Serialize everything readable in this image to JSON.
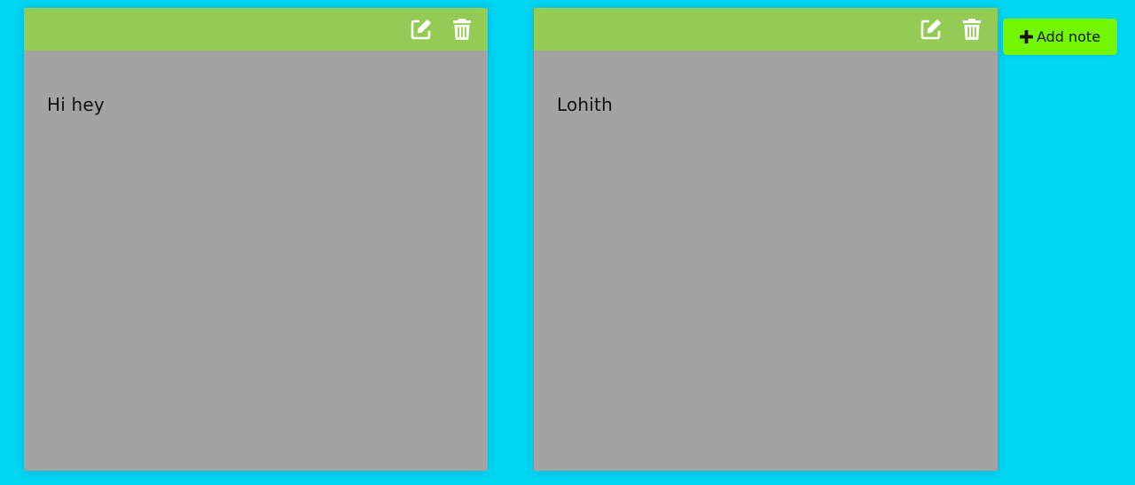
{
  "colors": {
    "background": "#00d7f5",
    "note_body": "#a3a3a3",
    "note_toolbar": "#93cb54",
    "add_button": "#72f700",
    "icon": "#ffffff"
  },
  "notes": [
    {
      "text": "Hi hey",
      "edit_icon": "edit-icon",
      "delete_icon": "trash-icon"
    },
    {
      "text": "Lohith",
      "edit_icon": "edit-icon",
      "delete_icon": "trash-icon"
    }
  ],
  "add_button": {
    "icon": "plus-icon",
    "label": "Add note"
  }
}
